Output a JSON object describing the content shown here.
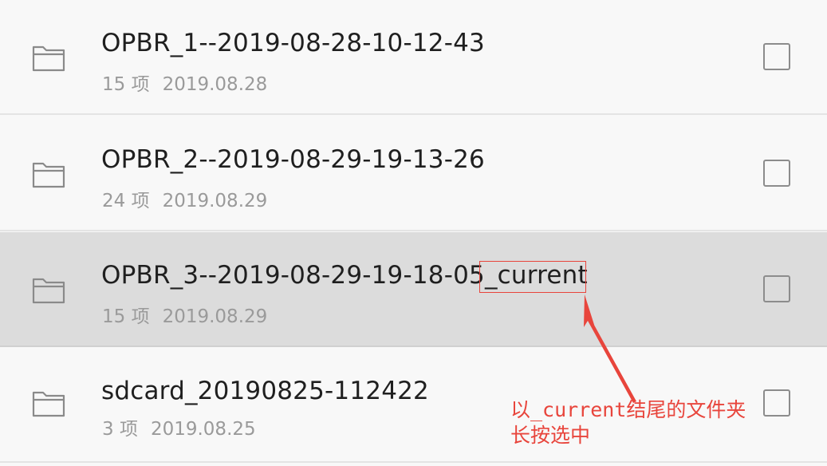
{
  "colors": {
    "background": "#f8f8f8",
    "selected_row": "#dcdcdc",
    "title_text": "#1f1f1f",
    "meta_text": "#9a9a9a",
    "annotation": "#e8453c"
  },
  "folders": [
    {
      "name": "OPBR_1--2019-08-28-10-12-43",
      "count": "15 项",
      "date": "2019.08.28",
      "selected": false
    },
    {
      "name": "OPBR_2--2019-08-29-19-13-26",
      "count": "24 项",
      "date": "2019.08.29",
      "selected": false
    },
    {
      "name_prefix": "OPBR_3--2019-08-29-19-18-05",
      "name_suffix": "_current",
      "count": "15 项",
      "date": "2019.08.29",
      "selected": true
    },
    {
      "name": "sdcard_20190825-112422",
      "count": "3 项",
      "date": "2019.08.25",
      "selected": false
    }
  ],
  "annotation": {
    "line1": "以_current结尾的文件夹",
    "line2": "长按选中"
  }
}
